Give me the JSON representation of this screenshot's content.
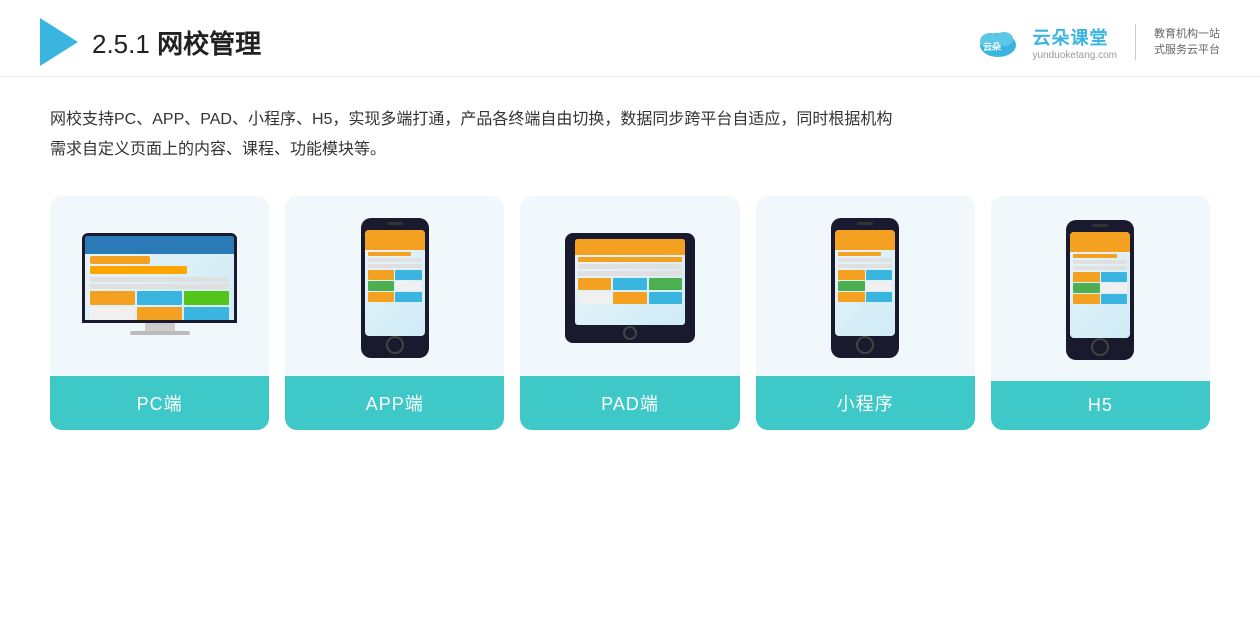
{
  "header": {
    "section_number": "2.5.1",
    "title_prefix": "2.5.1 ",
    "title_bold": "网校管理",
    "logo_main": "云朵课堂",
    "logo_site": "yunduoketang.com",
    "logo_slogan_line1": "教育机构一站",
    "logo_slogan_line2": "式服务云平台"
  },
  "description": {
    "line1": "网校支持PC、APP、PAD、小程序、H5，实现多端打通，产品各终端自由切换，数据同步跨平台自适应，同时根据机构",
    "line2": "需求自定义页面上的内容、课程、功能模块等。"
  },
  "cards": [
    {
      "id": "pc",
      "label": "PC端",
      "type": "pc"
    },
    {
      "id": "app",
      "label": "APP端",
      "type": "phone"
    },
    {
      "id": "pad",
      "label": "PAD端",
      "type": "tablet"
    },
    {
      "id": "mini",
      "label": "小程序",
      "type": "phone"
    },
    {
      "id": "h5",
      "label": "H5",
      "type": "phone"
    }
  ],
  "colors": {
    "card_bg": "#f0f8fc",
    "card_label_bg": "#3ec8c8",
    "card_label_text": "#ffffff"
  }
}
